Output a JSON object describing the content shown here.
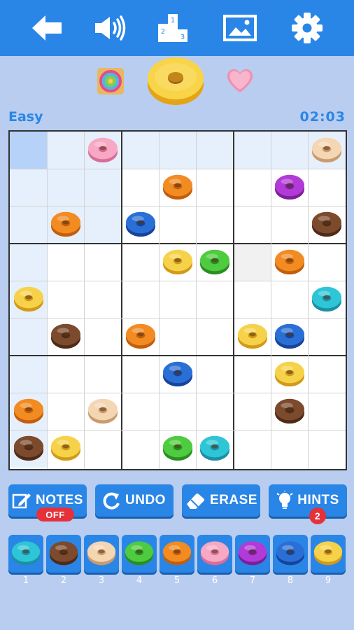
{
  "colors": {
    "1": [
      "#2ec5d6",
      "#1b8fa6"
    ],
    "2": [
      "#7c4a2d",
      "#4f2b17"
    ],
    "3": [
      "#f4d6b3",
      "#c99b6e"
    ],
    "4": [
      "#4ecb3f",
      "#2a8e22"
    ],
    "5": [
      "#f28b22",
      "#c35e0d"
    ],
    "6": [
      "#f7a8c4",
      "#d96d97"
    ],
    "7": [
      "#b23ad6",
      "#7a1f99"
    ],
    "8": [
      "#2a6fd6",
      "#16449a"
    ],
    "9": [
      "#f6d24a",
      "#d29a17"
    ]
  },
  "header": {
    "difficulty": "Easy",
    "timer": "02:03"
  },
  "toolbar_icons": [
    "back-arrow-icon",
    "sound-icon",
    "leaderboard-icon",
    "image-icon",
    "settings-gear-icon"
  ],
  "board": [
    [
      0,
      0,
      6,
      0,
      0,
      0,
      0,
      0,
      3
    ],
    [
      0,
      0,
      0,
      0,
      5,
      0,
      0,
      7,
      0
    ],
    [
      0,
      5,
      0,
      8,
      0,
      0,
      0,
      0,
      2
    ],
    [
      0,
      0,
      0,
      0,
      9,
      4,
      0,
      5,
      0
    ],
    [
      9,
      0,
      0,
      0,
      0,
      0,
      0,
      0,
      1
    ],
    [
      0,
      2,
      0,
      5,
      0,
      0,
      9,
      8,
      0
    ],
    [
      0,
      0,
      0,
      0,
      8,
      0,
      0,
      9,
      0
    ],
    [
      5,
      0,
      3,
      0,
      0,
      0,
      0,
      2,
      0
    ],
    [
      2,
      9,
      0,
      0,
      4,
      1,
      0,
      0,
      0
    ]
  ],
  "actions": {
    "notes": {
      "label": "NOTES",
      "state": "OFF"
    },
    "undo": {
      "label": "UNDO"
    },
    "erase": {
      "label": "ERASE"
    },
    "hints": {
      "label": "HINTS",
      "count": "2"
    }
  },
  "picker": [
    {
      "label": "1",
      "value": 1
    },
    {
      "label": "2",
      "value": 2
    },
    {
      "label": "3",
      "value": 3
    },
    {
      "label": "4",
      "value": 4
    },
    {
      "label": "5",
      "value": 5
    },
    {
      "label": "6",
      "value": 6
    },
    {
      "label": "7",
      "value": 7
    },
    {
      "label": "8",
      "value": 8
    },
    {
      "label": "9",
      "value": 9
    }
  ]
}
